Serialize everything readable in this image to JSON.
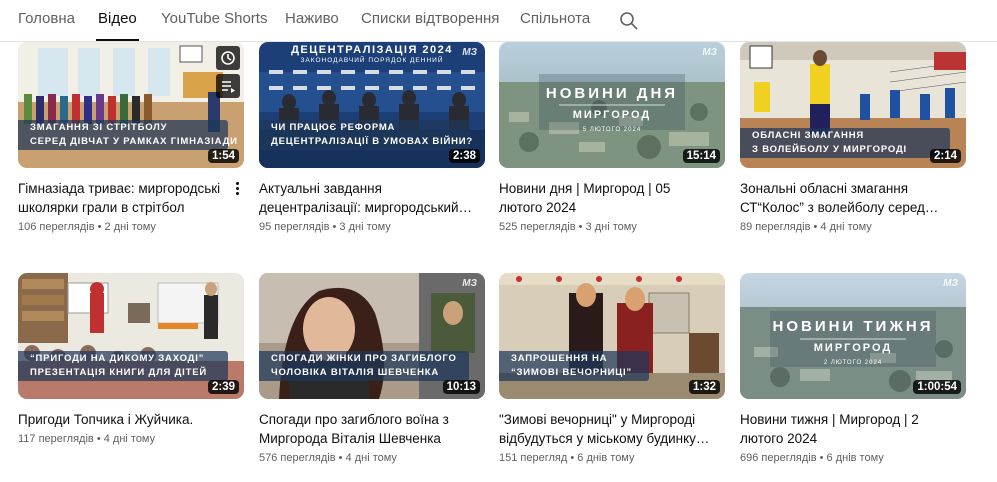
{
  "tabs": {
    "items": [
      "Головна",
      "Відео",
      "YouTube Shorts",
      "Наживо",
      "Списки відтворення",
      "Спільнота"
    ],
    "active": "Відео"
  },
  "videos": [
    {
      "title": "Гімназіада триває: миргородські школярки грали в стрітбол",
      "views": "106 переглядів",
      "age": "2 дні тому",
      "duration": "1:54",
      "caption": [
        "ЗМАГАННЯ ЗІ СТРІТБОЛУ",
        "СЕРЕД ДІВЧАТ У РАМКАХ ГІМНАЗІАДИ"
      ]
    },
    {
      "title": "Актуальні завдання децентралізації: миргородський…",
      "views": "95 переглядів",
      "age": "3 дні тому",
      "duration": "2:38",
      "caption": [
        "ЧИ ПРАЦЮЄ РЕФОРМА",
        "ДЕЦЕНТРАЛІЗАЦІЇ В УМОВАХ ВІЙНИ?"
      ],
      "banner": "ДЕЦЕНТРАЛІЗАЦІЯ 2024",
      "banner_sub": "ЗАКОНОДАВЧИЙ ПОРЯДОК ДЕННИЙ"
    },
    {
      "title": "Новини дня | Миргород | 05 лютого 2024",
      "views": "525 переглядів",
      "age": "3 дні тому",
      "duration": "15:14",
      "big_title": "НОВИНИ ДНЯ",
      "city": "МИРГОРОД",
      "date_line": "5 ЛЮТОГО 2024"
    },
    {
      "title": "Зональні обласні змагання СТ“Колос” з волейболу серед…",
      "views": "89 переглядів",
      "age": "4 дні тому",
      "duration": "2:14",
      "caption": [
        "ОБЛАСНІ ЗМАГАННЯ",
        "З ВОЛЕЙБОЛУ У МИРГОРОДІ"
      ]
    },
    {
      "title": "Пригоди Топчика і Жуйчика.",
      "views": "117 переглядів",
      "age": "4 дні тому",
      "duration": "2:39",
      "caption": [
        "“ПРИГОДИ НА ДИКОМУ ЗАХОДІ”",
        "ПРЕЗЕНТАЦІЯ КНИГИ ДЛЯ ДІТЕЙ"
      ]
    },
    {
      "title": "Спогади про загиблого воїна з Миргорода Віталія Шевченка",
      "views": "576 переглядів",
      "age": "4 дні тому",
      "duration": "10:13",
      "caption": [
        "СПОГАДИ ЖІНКИ ПРО ЗАГИБЛОГО",
        "ЧОЛОВІКА ВІТАЛІЯ ШЕВЧЕНКА"
      ]
    },
    {
      "title": "\"Зимові вечорниці\" у Миргороді відбудуться у міському будинку…",
      "views": "151 перегляд",
      "age": "6 днів тому",
      "duration": "1:32",
      "caption": [
        "ЗАПРОШЕННЯ НА",
        "“ЗИМОВІ ВЕЧОРНИЦІ”"
      ]
    },
    {
      "title": "Новини тижня | Миргород | 2 лютого 2024",
      "views": "696 переглядів",
      "age": "6 днів тому",
      "duration": "1:00:54",
      "big_title": "НОВИНИ ТИЖНЯ",
      "city": "МИРГОРОД",
      "date_line": "2 ЛЮТОГО 2024"
    }
  ],
  "meta_separator": " • ",
  "watermark": "МЗ",
  "colors": {
    "text": "#0f0f0f",
    "secondary": "#606060",
    "caption_bg": "#1e375a",
    "badge_bg": "#000000"
  },
  "icons": [
    "search-icon",
    "clock-icon",
    "queue-icon",
    "more-vert-icon"
  ]
}
